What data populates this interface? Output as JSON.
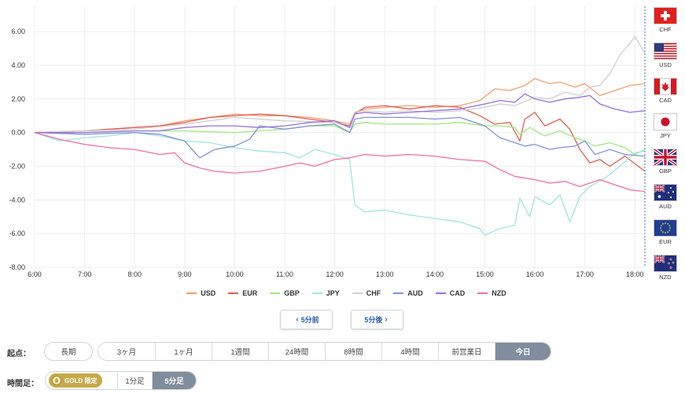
{
  "chart_data": {
    "type": "line",
    "x_ticks": [
      "6:00",
      "7:00",
      "8:00",
      "9:00",
      "10:00",
      "11:00",
      "12:00",
      "13:00",
      "14:00",
      "15:00",
      "16:00",
      "17:00",
      "18:00"
    ],
    "y_ticks": [
      "6.00",
      "4.00",
      "2.00",
      "0.00",
      "-2.00",
      "-4.00",
      "-6.00",
      "-8.00"
    ],
    "ylim": [
      -8,
      7.5
    ],
    "xlim": [
      6.0,
      18.2
    ],
    "grid": true,
    "legend_position": "bottom",
    "series": [
      {
        "name": "USD",
        "color": "#f0a070",
        "points": [
          [
            6.0,
            0.0
          ],
          [
            7.0,
            0.1
          ],
          [
            8.0,
            0.3
          ],
          [
            8.5,
            0.4
          ],
          [
            9.0,
            0.7
          ],
          [
            9.5,
            0.9
          ],
          [
            10.0,
            1.1
          ],
          [
            10.5,
            1.0
          ],
          [
            11.0,
            1.0
          ],
          [
            11.5,
            0.9
          ],
          [
            12.0,
            0.7
          ],
          [
            12.3,
            0.5
          ],
          [
            12.4,
            1.2
          ],
          [
            12.6,
            1.4
          ],
          [
            13.0,
            1.5
          ],
          [
            13.5,
            1.6
          ],
          [
            14.0,
            1.5
          ],
          [
            14.5,
            1.6
          ],
          [
            14.9,
            1.9
          ],
          [
            15.2,
            2.6
          ],
          [
            15.5,
            2.5
          ],
          [
            15.8,
            2.8
          ],
          [
            16.0,
            3.2
          ],
          [
            16.3,
            2.9
          ],
          [
            16.5,
            3.0
          ],
          [
            16.8,
            2.7
          ],
          [
            17.0,
            2.9
          ],
          [
            17.3,
            2.2
          ],
          [
            17.6,
            2.5
          ],
          [
            17.9,
            2.8
          ],
          [
            18.2,
            2.9
          ]
        ]
      },
      {
        "name": "EUR",
        "color": "#e06050",
        "points": [
          [
            6.0,
            0.0
          ],
          [
            7.0,
            0.1
          ],
          [
            8.0,
            0.3
          ],
          [
            8.5,
            0.4
          ],
          [
            9.0,
            0.6
          ],
          [
            9.5,
            0.9
          ],
          [
            10.0,
            1.0
          ],
          [
            10.5,
            1.1
          ],
          [
            11.0,
            1.0
          ],
          [
            11.5,
            0.8
          ],
          [
            12.0,
            0.6
          ],
          [
            12.3,
            0.4
          ],
          [
            12.4,
            1.1
          ],
          [
            12.6,
            1.5
          ],
          [
            13.0,
            1.6
          ],
          [
            13.5,
            1.4
          ],
          [
            14.0,
            1.6
          ],
          [
            14.5,
            1.5
          ],
          [
            14.9,
            1.0
          ],
          [
            15.2,
            0.5
          ],
          [
            15.5,
            0.6
          ],
          [
            15.7,
            -0.5
          ],
          [
            15.8,
            0.8
          ],
          [
            16.0,
            1.2
          ],
          [
            16.2,
            0.4
          ],
          [
            16.5,
            0.8
          ],
          [
            16.7,
            0.2
          ],
          [
            16.9,
            -1.0
          ],
          [
            17.1,
            -1.8
          ],
          [
            17.3,
            -1.6
          ],
          [
            17.5,
            -2.0
          ],
          [
            17.8,
            -1.4
          ],
          [
            18.2,
            -2.3
          ]
        ]
      },
      {
        "name": "GBP",
        "color": "#a0e880",
        "points": [
          [
            6.0,
            0.0
          ],
          [
            7.0,
            0.0
          ],
          [
            8.0,
            0.1
          ],
          [
            9.0,
            0.1
          ],
          [
            10.0,
            0.0
          ],
          [
            11.0,
            0.2
          ],
          [
            11.5,
            0.4
          ],
          [
            12.0,
            0.4
          ],
          [
            12.3,
            0.0
          ],
          [
            12.4,
            0.5
          ],
          [
            12.6,
            0.6
          ],
          [
            13.0,
            0.5
          ],
          [
            13.5,
            0.5
          ],
          [
            14.0,
            0.5
          ],
          [
            14.5,
            0.6
          ],
          [
            15.0,
            0.4
          ],
          [
            15.3,
            0.4
          ],
          [
            15.6,
            0.3
          ],
          [
            15.7,
            -0.1
          ],
          [
            15.9,
            0.3
          ],
          [
            16.2,
            -0.2
          ],
          [
            16.5,
            0.1
          ],
          [
            16.8,
            -0.3
          ],
          [
            17.0,
            -0.5
          ],
          [
            17.2,
            -0.8
          ],
          [
            17.5,
            -0.6
          ],
          [
            17.8,
            -0.9
          ],
          [
            18.0,
            -1.3
          ],
          [
            18.2,
            -1.0
          ]
        ]
      },
      {
        "name": "JPY",
        "color": "#9ee6dc",
        "points": [
          [
            6.0,
            0.0
          ],
          [
            6.5,
            -0.5
          ],
          [
            7.0,
            -0.3
          ],
          [
            7.5,
            -0.2
          ],
          [
            8.0,
            0.0
          ],
          [
            8.5,
            -0.2
          ],
          [
            9.0,
            -0.5
          ],
          [
            9.5,
            -0.6
          ],
          [
            10.0,
            -0.9
          ],
          [
            10.5,
            -1.1
          ],
          [
            11.0,
            -1.2
          ],
          [
            11.3,
            -1.5
          ],
          [
            11.6,
            -1.0
          ],
          [
            12.0,
            -1.3
          ],
          [
            12.3,
            -1.6
          ],
          [
            12.4,
            -4.3
          ],
          [
            12.6,
            -4.7
          ],
          [
            13.0,
            -4.6
          ],
          [
            13.5,
            -4.9
          ],
          [
            14.0,
            -5.1
          ],
          [
            14.5,
            -5.3
          ],
          [
            14.9,
            -5.7
          ],
          [
            15.0,
            -6.1
          ],
          [
            15.3,
            -5.7
          ],
          [
            15.6,
            -5.5
          ],
          [
            15.7,
            -3.9
          ],
          [
            15.9,
            -5.0
          ],
          [
            16.0,
            -3.8
          ],
          [
            16.3,
            -4.3
          ],
          [
            16.5,
            -3.7
          ],
          [
            16.7,
            -5.3
          ],
          [
            16.9,
            -3.8
          ],
          [
            17.1,
            -3.2
          ],
          [
            17.4,
            -2.7
          ],
          [
            17.7,
            -2.0
          ],
          [
            18.0,
            -1.2
          ],
          [
            18.2,
            -1.1
          ]
        ]
      },
      {
        "name": "CHF",
        "color": "#cfcfcf",
        "points": [
          [
            6.0,
            0.0
          ],
          [
            7.0,
            0.1
          ],
          [
            8.0,
            0.2
          ],
          [
            9.0,
            0.5
          ],
          [
            10.0,
            0.9
          ],
          [
            11.0,
            0.7
          ],
          [
            12.0,
            0.6
          ],
          [
            12.3,
            0.3
          ],
          [
            12.4,
            1.2
          ],
          [
            12.6,
            1.3
          ],
          [
            13.0,
            1.2
          ],
          [
            13.5,
            1.3
          ],
          [
            14.0,
            1.2
          ],
          [
            14.5,
            1.3
          ],
          [
            15.0,
            1.5
          ],
          [
            15.3,
            1.7
          ],
          [
            15.6,
            1.6
          ],
          [
            16.0,
            2.1
          ],
          [
            16.3,
            2.0
          ],
          [
            16.6,
            2.4
          ],
          [
            16.9,
            2.2
          ],
          [
            17.1,
            2.7
          ],
          [
            17.3,
            2.8
          ],
          [
            17.5,
            3.5
          ],
          [
            17.7,
            4.6
          ],
          [
            17.9,
            5.3
          ],
          [
            18.0,
            5.7
          ],
          [
            18.2,
            4.7
          ]
        ]
      },
      {
        "name": "AUD",
        "color": "#7f93d8",
        "points": [
          [
            6.0,
            0.0
          ],
          [
            7.0,
            -0.1
          ],
          [
            8.0,
            0.0
          ],
          [
            8.5,
            -0.1
          ],
          [
            9.0,
            -0.5
          ],
          [
            9.3,
            -1.5
          ],
          [
            9.6,
            -1.0
          ],
          [
            10.0,
            -0.8
          ],
          [
            10.3,
            -0.4
          ],
          [
            10.5,
            0.4
          ],
          [
            11.0,
            0.2
          ],
          [
            11.5,
            0.4
          ],
          [
            12.0,
            0.5
          ],
          [
            12.3,
            0.0
          ],
          [
            12.4,
            0.8
          ],
          [
            12.6,
            0.9
          ],
          [
            13.0,
            0.9
          ],
          [
            13.5,
            0.9
          ],
          [
            14.0,
            0.8
          ],
          [
            14.5,
            0.9
          ],
          [
            15.0,
            0.4
          ],
          [
            15.3,
            -0.3
          ],
          [
            15.6,
            -0.6
          ],
          [
            15.8,
            -0.8
          ],
          [
            16.0,
            -0.7
          ],
          [
            16.3,
            -1.0
          ],
          [
            16.5,
            -0.9
          ],
          [
            16.8,
            -0.8
          ],
          [
            17.0,
            -0.5
          ],
          [
            17.2,
            -1.3
          ],
          [
            17.5,
            -1.0
          ],
          [
            17.8,
            -1.3
          ],
          [
            18.2,
            -1.4
          ]
        ]
      },
      {
        "name": "CAD",
        "color": "#9a6fd8",
        "points": [
          [
            6.0,
            0.0
          ],
          [
            7.0,
            0.0
          ],
          [
            8.0,
            0.1
          ],
          [
            8.5,
            0.1
          ],
          [
            9.0,
            0.3
          ],
          [
            9.5,
            0.4
          ],
          [
            10.0,
            0.4
          ],
          [
            10.5,
            0.3
          ],
          [
            11.0,
            0.4
          ],
          [
            11.5,
            0.6
          ],
          [
            12.0,
            0.7
          ],
          [
            12.3,
            0.3
          ],
          [
            12.4,
            1.1
          ],
          [
            12.6,
            1.2
          ],
          [
            13.0,
            1.1
          ],
          [
            13.5,
            1.2
          ],
          [
            14.0,
            1.3
          ],
          [
            14.5,
            1.4
          ],
          [
            15.0,
            1.7
          ],
          [
            15.3,
            1.9
          ],
          [
            15.6,
            1.8
          ],
          [
            15.8,
            2.3
          ],
          [
            16.0,
            2.0
          ],
          [
            16.3,
            1.8
          ],
          [
            16.6,
            2.0
          ],
          [
            16.9,
            2.1
          ],
          [
            17.1,
            2.2
          ],
          [
            17.3,
            1.7
          ],
          [
            17.6,
            1.4
          ],
          [
            17.9,
            1.2
          ],
          [
            18.2,
            1.3
          ]
        ]
      },
      {
        "name": "NZD",
        "color": "#ee6ea8",
        "points": [
          [
            6.0,
            0.0
          ],
          [
            6.5,
            -0.4
          ],
          [
            7.0,
            -0.7
          ],
          [
            7.5,
            -0.9
          ],
          [
            8.0,
            -1.0
          ],
          [
            8.5,
            -1.3
          ],
          [
            8.8,
            -1.2
          ],
          [
            9.0,
            -1.8
          ],
          [
            9.3,
            -2.1
          ],
          [
            9.6,
            -2.3
          ],
          [
            10.0,
            -2.4
          ],
          [
            10.5,
            -2.3
          ],
          [
            11.0,
            -2.0
          ],
          [
            11.3,
            -1.8
          ],
          [
            11.6,
            -2.0
          ],
          [
            12.0,
            -1.6
          ],
          [
            12.3,
            -1.5
          ],
          [
            12.6,
            -1.3
          ],
          [
            13.0,
            -1.4
          ],
          [
            13.5,
            -1.3
          ],
          [
            14.0,
            -1.4
          ],
          [
            14.5,
            -1.6
          ],
          [
            15.0,
            -1.7
          ],
          [
            15.3,
            -2.2
          ],
          [
            15.6,
            -2.6
          ],
          [
            16.0,
            -2.8
          ],
          [
            16.3,
            -3.0
          ],
          [
            16.6,
            -2.9
          ],
          [
            16.9,
            -3.2
          ],
          [
            17.1,
            -3.0
          ],
          [
            17.3,
            -2.8
          ],
          [
            17.6,
            -3.1
          ],
          [
            17.9,
            -3.4
          ],
          [
            18.2,
            -3.5
          ]
        ]
      }
    ]
  },
  "flags": [
    {
      "code": "CHF",
      "icon": "flag-ch-icon"
    },
    {
      "code": "USD",
      "icon": "flag-us-icon"
    },
    {
      "code": "CAD",
      "icon": "flag-ca-icon"
    },
    {
      "code": "JPY",
      "icon": "flag-jp-icon"
    },
    {
      "code": "GBP",
      "icon": "flag-gb-icon"
    },
    {
      "code": "AUD",
      "icon": "flag-au-icon"
    },
    {
      "code": "EUR",
      "icon": "flag-eu-icon"
    },
    {
      "code": "NZD",
      "icon": "flag-nz-icon"
    }
  ],
  "nav": {
    "prev_label": "5分前",
    "next_label": "5分後",
    "prev_icon": "chevron-left-icon",
    "next_icon": "chevron-right-icon"
  },
  "origin": {
    "label": "起点：",
    "options": [
      "長期",
      "3ヶ月",
      "1ヶ月",
      "1週間",
      "24時間",
      "8時間",
      "4時間",
      "前営業日",
      "今日"
    ],
    "selected": "今日"
  },
  "timeframe": {
    "label": "時間足：",
    "gold_label": "GOLD 限定",
    "gold_icon": "gold-medal-icon",
    "options": [
      "1分足",
      "5分足"
    ],
    "selected": "5分足"
  }
}
